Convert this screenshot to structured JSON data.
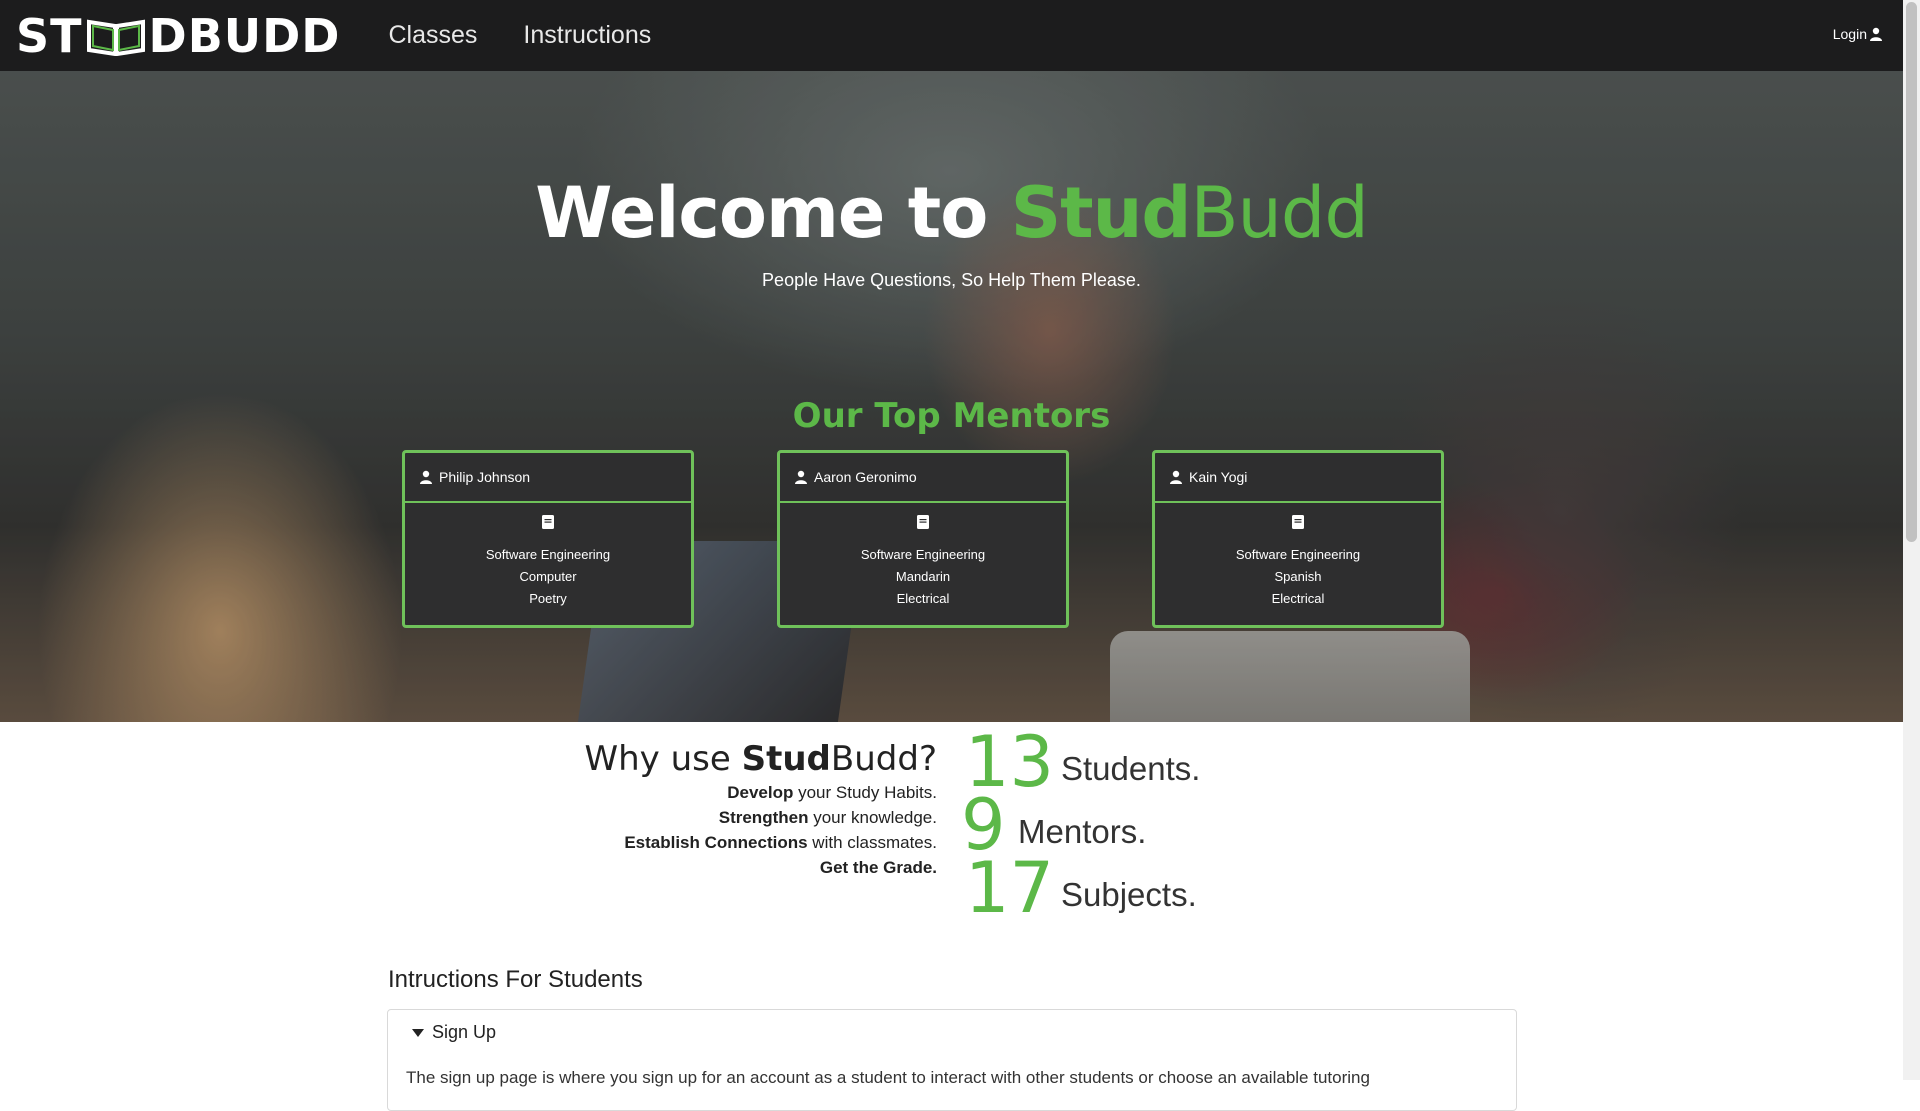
{
  "navbar": {
    "logo": {
      "left": "ST",
      "right": "DBUDD"
    },
    "links": [
      "Classes",
      "Instructions"
    ],
    "login_label": "Login"
  },
  "hero": {
    "title_prefix": "Welcome to ",
    "title_stud": "Stud",
    "title_budd": "Budd",
    "subtitle": "People Have Questions, So Help Them Please."
  },
  "mentors": {
    "heading": "Our Top Mentors",
    "cards": [
      {
        "name": "Philip Johnson",
        "subjects": [
          "Software Engineering",
          "Computer",
          "Poetry"
        ]
      },
      {
        "name": "Aaron Geronimo",
        "subjects": [
          "Software Engineering",
          "Mandarin",
          "Electrical"
        ]
      },
      {
        "name": "Kain Yogi",
        "subjects": [
          "Software Engineering",
          "Spanish",
          "Electrical"
        ]
      }
    ]
  },
  "why": {
    "title_prefix": "Why use ",
    "title_stud": "Stud",
    "title_budd": "Budd?",
    "lines": [
      {
        "bold": "Develop",
        "rest": " your Study Habits."
      },
      {
        "bold": "Strengthen",
        "rest": " your knowledge."
      },
      {
        "bold": "Establish Connections",
        "rest": " with classmates."
      },
      {
        "bold": "Get the Grade.",
        "rest": ""
      }
    ]
  },
  "stats": [
    {
      "number": "13",
      "label": "Students."
    },
    {
      "number": "9",
      "label": "Mentors."
    },
    {
      "number": "17",
      "label": "Subjects."
    }
  ],
  "instructions": {
    "heading": "Intructions For Students",
    "items": [
      {
        "title": "Sign Up",
        "text": "The sign up page is where you sign up for an account as a student to interact with other students or choose an available tutoring"
      }
    ]
  },
  "colors": {
    "accent": "#5cb848",
    "navbar": "#1c1c1d",
    "card": "#2e2e2f"
  }
}
